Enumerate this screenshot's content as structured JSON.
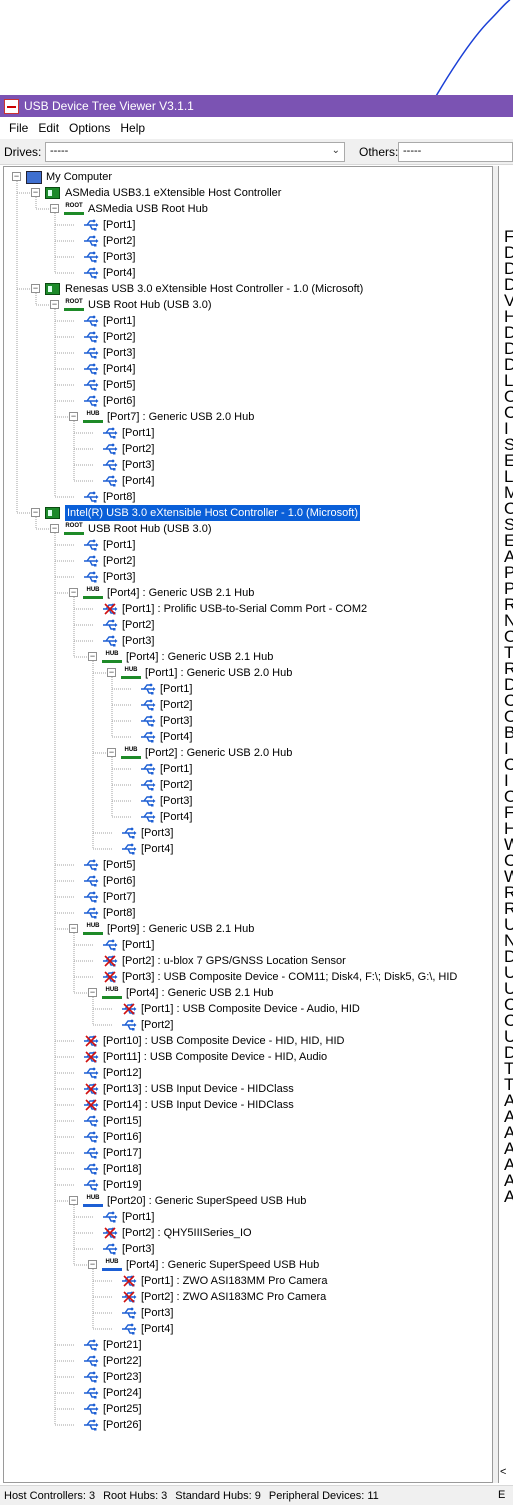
{
  "window": {
    "title": "USB Device Tree Viewer V3.1.1"
  },
  "menu": [
    "File",
    "Edit",
    "Options",
    "Help"
  ],
  "toolbar": {
    "drives_label": "Drives:",
    "drives_value": "-----",
    "others_label": "Others:",
    "others_value": "-----"
  },
  "tree": [
    {
      "d": 0,
      "icon": "pc",
      "text": "My Computer",
      "exp": "-"
    },
    {
      "d": 1,
      "icon": "ctrl",
      "text": "ASMedia USB3.1 eXtensible Host Controller",
      "exp": "-"
    },
    {
      "d": 2,
      "icon": "root",
      "text": "ASMedia USB Root Hub",
      "exp": "-"
    },
    {
      "d": 3,
      "icon": "port3",
      "text": "[Port1]"
    },
    {
      "d": 3,
      "icon": "port3",
      "text": "[Port2]"
    },
    {
      "d": 3,
      "icon": "port2",
      "text": "[Port3]"
    },
    {
      "d": 3,
      "icon": "port2",
      "text": "[Port4]"
    },
    {
      "d": 1,
      "icon": "ctrl",
      "text": "Renesas USB 3.0 eXtensible Host Controller - 1.0 (Microsoft)",
      "exp": "-"
    },
    {
      "d": 2,
      "icon": "root",
      "text": "USB Root Hub (USB 3.0)",
      "exp": "-"
    },
    {
      "d": 3,
      "icon": "port3",
      "text": "[Port1]"
    },
    {
      "d": 3,
      "icon": "port3",
      "text": "[Port2]"
    },
    {
      "d": 3,
      "icon": "port3",
      "text": "[Port3]"
    },
    {
      "d": 3,
      "icon": "port3",
      "text": "[Port4]"
    },
    {
      "d": 3,
      "icon": "port2",
      "text": "[Port5]"
    },
    {
      "d": 3,
      "icon": "port2",
      "text": "[Port6]"
    },
    {
      "d": 3,
      "icon": "hub",
      "text": "[Port7] : Generic USB 2.0 Hub",
      "exp": "-"
    },
    {
      "d": 4,
      "icon": "port2",
      "text": "[Port1]"
    },
    {
      "d": 4,
      "icon": "port2",
      "text": "[Port2]"
    },
    {
      "d": 4,
      "icon": "port2",
      "text": "[Port3]"
    },
    {
      "d": 4,
      "icon": "port2",
      "text": "[Port4]"
    },
    {
      "d": 3,
      "icon": "port2",
      "text": "[Port8]"
    },
    {
      "d": 1,
      "icon": "ctrl",
      "text": "Intel(R) USB 3.0 eXtensible Host Controller - 1.0 (Microsoft)",
      "exp": "-",
      "selected": true
    },
    {
      "d": 2,
      "icon": "root",
      "text": "USB Root Hub (USB 3.0)",
      "exp": "-"
    },
    {
      "d": 3,
      "icon": "port2",
      "text": "[Port1]"
    },
    {
      "d": 3,
      "icon": "port2",
      "text": "[Port2]"
    },
    {
      "d": 3,
      "icon": "port2",
      "text": "[Port3]"
    },
    {
      "d": 3,
      "icon": "hub",
      "text": "[Port4] : Generic USB 2.1 Hub",
      "exp": "-"
    },
    {
      "d": 4,
      "icon": "dev",
      "text": "[Port1] : Prolific USB-to-Serial Comm Port - COM2"
    },
    {
      "d": 4,
      "icon": "port2",
      "text": "[Port2]"
    },
    {
      "d": 4,
      "icon": "port2",
      "text": "[Port3]"
    },
    {
      "d": 4,
      "icon": "hub",
      "text": "[Port4] : Generic USB 2.1 Hub",
      "exp": "-"
    },
    {
      "d": 5,
      "icon": "hub",
      "text": "[Port1] : Generic USB 2.0 Hub",
      "exp": "-"
    },
    {
      "d": 6,
      "icon": "port2",
      "text": "[Port1]"
    },
    {
      "d": 6,
      "icon": "port2",
      "text": "[Port2]"
    },
    {
      "d": 6,
      "icon": "port2",
      "text": "[Port3]"
    },
    {
      "d": 6,
      "icon": "port2",
      "text": "[Port4]"
    },
    {
      "d": 5,
      "icon": "hub",
      "text": "[Port2] : Generic USB 2.0 Hub",
      "exp": "-"
    },
    {
      "d": 6,
      "icon": "port2",
      "text": "[Port1]"
    },
    {
      "d": 6,
      "icon": "port2",
      "text": "[Port2]"
    },
    {
      "d": 6,
      "icon": "port2",
      "text": "[Port3]"
    },
    {
      "d": 6,
      "icon": "port2",
      "text": "[Port4]"
    },
    {
      "d": 5,
      "icon": "port2",
      "text": "[Port3]"
    },
    {
      "d": 5,
      "icon": "port2",
      "text": "[Port4]"
    },
    {
      "d": 3,
      "icon": "port2",
      "text": "[Port5]"
    },
    {
      "d": 3,
      "icon": "port2",
      "text": "[Port6]"
    },
    {
      "d": 3,
      "icon": "port2",
      "text": "[Port7]"
    },
    {
      "d": 3,
      "icon": "port2",
      "text": "[Port8]"
    },
    {
      "d": 3,
      "icon": "hub",
      "text": "[Port9] : Generic USB 2.1 Hub",
      "exp": "-"
    },
    {
      "d": 4,
      "icon": "port2",
      "text": "[Port1]"
    },
    {
      "d": 4,
      "icon": "dev",
      "text": "[Port2] : u-blox 7 GPS/GNSS Location Sensor"
    },
    {
      "d": 4,
      "icon": "dev",
      "text": "[Port3] : USB Composite Device - COM11; Disk4, F:\\; Disk5, G:\\, HID"
    },
    {
      "d": 4,
      "icon": "hub",
      "text": "[Port4] : Generic USB 2.1 Hub",
      "exp": "-"
    },
    {
      "d": 5,
      "icon": "dev",
      "text": "[Port1] : USB Composite Device - Audio, HID"
    },
    {
      "d": 5,
      "icon": "port2",
      "text": "[Port2]"
    },
    {
      "d": 3,
      "icon": "dev",
      "text": "[Port10] : USB Composite Device - HID, HID, HID"
    },
    {
      "d": 3,
      "icon": "dev",
      "text": "[Port11] : USB Composite Device - HID, Audio"
    },
    {
      "d": 3,
      "icon": "port2",
      "text": "[Port12]"
    },
    {
      "d": 3,
      "icon": "dev",
      "text": "[Port13] : USB Input Device - HIDClass"
    },
    {
      "d": 3,
      "icon": "dev",
      "text": "[Port14] : USB Input Device - HIDClass"
    },
    {
      "d": 3,
      "icon": "port2",
      "text": "[Port15]"
    },
    {
      "d": 3,
      "icon": "port2",
      "text": "[Port16]"
    },
    {
      "d": 3,
      "icon": "port2",
      "text": "[Port17]"
    },
    {
      "d": 3,
      "icon": "port2",
      "text": "[Port18]"
    },
    {
      "d": 3,
      "icon": "port2",
      "text": "[Port19]"
    },
    {
      "d": 3,
      "icon": "hubss",
      "text": "[Port20] : Generic SuperSpeed USB Hub",
      "exp": "-"
    },
    {
      "d": 4,
      "icon": "port3",
      "text": "[Port1]"
    },
    {
      "d": 4,
      "icon": "dev",
      "text": "[Port2] : QHY5IIISeries_IO"
    },
    {
      "d": 4,
      "icon": "port3",
      "text": "[Port3]"
    },
    {
      "d": 4,
      "icon": "hubss",
      "text": "[Port4] : Generic SuperSpeed USB Hub",
      "exp": "-"
    },
    {
      "d": 5,
      "icon": "dev",
      "text": "[Port1] : ZWO ASI183MM Pro Camera"
    },
    {
      "d": 5,
      "icon": "dev",
      "text": "[Port2] : ZWO ASI183MC Pro Camera"
    },
    {
      "d": 5,
      "icon": "port3",
      "text": "[Port3]"
    },
    {
      "d": 5,
      "icon": "port3",
      "text": "[Port4]"
    },
    {
      "d": 3,
      "icon": "port3",
      "text": "[Port21]"
    },
    {
      "d": 3,
      "icon": "port3",
      "text": "[Port22]"
    },
    {
      "d": 3,
      "icon": "port3",
      "text": "[Port23]"
    },
    {
      "d": 3,
      "icon": "port3",
      "text": "[Port24]"
    },
    {
      "d": 3,
      "icon": "port3",
      "text": "[Port25]"
    },
    {
      "d": 3,
      "icon": "port3",
      "text": "[Port26]"
    }
  ],
  "right_pane_letters": "FDDDVHDDDLOCISELMOSEAP     PRNOT    R  DCOBICIOFHWCWRRUN    DUUCCU   DTTAAAAAAA",
  "right_pane_scroll": "<",
  "status": {
    "host_controllers": "Host Controllers: 3",
    "root_hubs": "Root Hubs: 3",
    "standard_hubs": "Standard Hubs: 9",
    "peripheral_devices": "Peripheral Devices: 11",
    "right": "E"
  },
  "colors": {
    "titlebar": "#7b53b3",
    "selection": "#0a5fd8",
    "pen_stroke": "#1a3fd6"
  }
}
